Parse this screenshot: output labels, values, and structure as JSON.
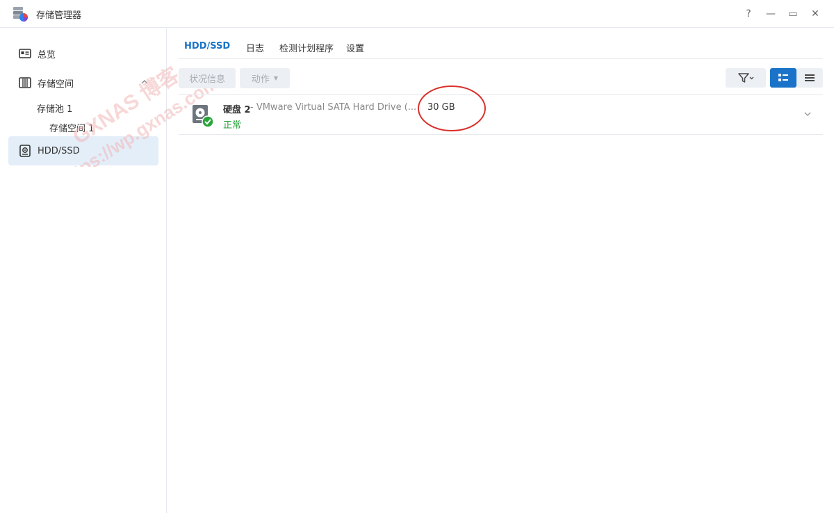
{
  "window": {
    "title": "存储管理器",
    "controls": [
      "?",
      "—",
      "▭",
      "✕"
    ]
  },
  "sidebar": {
    "items": [
      {
        "label": "总览",
        "icon": "overview-icon"
      },
      {
        "label": "存储空间",
        "icon": "storage-icon"
      },
      {
        "label": "存储池 1"
      },
      {
        "label": "存储空间 1"
      },
      {
        "label": "HDD/SSD",
        "icon": "hdd-icon",
        "active": true
      }
    ]
  },
  "tabs": [
    {
      "label": "HDD/SSD",
      "active": true
    },
    {
      "label": "日志"
    },
    {
      "label": "检测计划程序"
    },
    {
      "label": "设置"
    }
  ],
  "toolbar": {
    "status_label": "状况信息",
    "action_label": "动作",
    "filter_icon": "filter-icon",
    "view_list_icon": "detail-view-icon",
    "view_compact_icon": "list-view-icon"
  },
  "disk": {
    "name": "硬盘 2",
    "model": "- VMware Virtual SATA Hard Drive (...",
    "size": "30 GB",
    "status": "正常",
    "status_color": "#27a13a"
  },
  "watermark": {
    "line1": "GXNAS 博客",
    "line2": "https://wp.gxnas.com"
  },
  "colors": {
    "accent": "#1a73c8",
    "active_bg": "#e3eef9",
    "annotation": "#d9312b"
  }
}
